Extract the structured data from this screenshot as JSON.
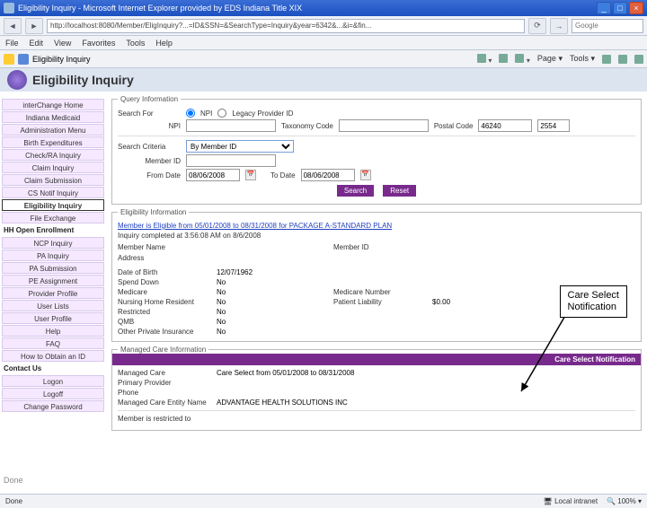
{
  "window": {
    "title": "Eligibility Inquiry - Microsoft Internet Explorer provided by EDS Indiana Title XIX",
    "min": "_",
    "max": "□",
    "close": "×"
  },
  "toolbar": {
    "back": "◄",
    "fwd": "►",
    "refresh": "⟳",
    "go": "→",
    "url": "http://localhost:8080/Member/EligInquiry?...=ID&SSN=&SearchType=Inquiry&year=6342&...&i=&fin...",
    "search_placeholder": "Google"
  },
  "menu": {
    "file": "File",
    "edit": "Edit",
    "view": "View",
    "favorites": "Favorites",
    "tools": "Tools",
    "help": "Help"
  },
  "linkbar": {
    "tab": "Eligibility Inquiry",
    "home": "▾",
    "print": "▾",
    "page": "Page ▾",
    "tools": "Tools ▾"
  },
  "page": {
    "title": "Eligibility Inquiry"
  },
  "sidebar": {
    "items": [
      {
        "label": "interChange Home"
      },
      {
        "label": "Indiana Medicaid"
      },
      {
        "label": "Administration Menu"
      },
      {
        "label": "Birth Expenditures"
      },
      {
        "label": "Check/RA Inquiry"
      },
      {
        "label": "Claim Inquiry"
      },
      {
        "label": "Claim Submission"
      },
      {
        "label": "CS Notif Inquiry"
      },
      {
        "label": "Eligibility Inquiry"
      },
      {
        "label": "File Exchange"
      },
      {
        "label": "HH Open Enrollment"
      },
      {
        "label": "NCP Inquiry"
      },
      {
        "label": "PA Inquiry"
      },
      {
        "label": "PA Submission"
      },
      {
        "label": "PE Assignment"
      },
      {
        "label": "Provider Profile"
      },
      {
        "label": "User Lists"
      },
      {
        "label": "User Profile"
      },
      {
        "label": "Help"
      },
      {
        "label": "FAQ"
      },
      {
        "label": "How to Obtain an ID"
      },
      {
        "label": "Contact Us"
      },
      {
        "label": "Logon"
      },
      {
        "label": "Logoff"
      },
      {
        "label": "Change Password"
      }
    ],
    "active_index": 8,
    "heading_indices": [
      10,
      21
    ]
  },
  "query": {
    "legend": "Query Information",
    "search_for": "Search For",
    "npi": "NPI",
    "legacy": "Legacy Provider ID",
    "npi_label": "NPI",
    "taxonomy": "Taxonomy Code",
    "zip": "Postal Code",
    "zip_val1": "46240",
    "zip_val2": "2554",
    "criteria_label": "Search Criteria",
    "criteria_val": "By Member ID",
    "member_label": "Member ID",
    "from_label": "From Date",
    "from_val": "08/06/2008",
    "to_label": "To Date",
    "to_val": "08/06/2008",
    "search": "Search",
    "reset": "Reset"
  },
  "elig": {
    "legend": "Eligibility Information",
    "line1": "Member is Eligible from 05/01/2008 to 08/31/2008 for PACKAGE A-STANDARD PLAN",
    "line2": "Inquiry completed at 3:56:08 AM on 8/6/2008",
    "member_name": "Member Name",
    "member_id": "Member ID",
    "address": "Address",
    "dob": "Date of Birth",
    "dob_val": "12/07/1962",
    "spend": "Spend Down",
    "spend_val": "No",
    "medicare": "Medicare",
    "medicare_val": "No",
    "medicare_num": "Medicare Number",
    "nursing": "Nursing Home Resident",
    "nursing_val": "No",
    "liability": "Patient Liability",
    "liability_val": "$0.00",
    "restricted": "Restricted",
    "restricted_val": "No",
    "qmb": "QMB",
    "qmb_val": "No",
    "other": "Other Private Insurance",
    "other_val": "No"
  },
  "managed": {
    "legend": "Managed Care Information",
    "bar": "Care Select Notification",
    "mc_label": "Managed Care",
    "mc_val": "Care Select from 05/01/2008 to 08/31/2008",
    "pp": "Primary Provider",
    "phone": "Phone",
    "entity_label": "Managed Care Entity Name",
    "entity_val": "ADVANTAGE HEALTH SOLUTIONS INC",
    "restricted": "Member is restricted to"
  },
  "callout": {
    "l1": "Care Select",
    "l2": "Notification"
  },
  "status": {
    "done": "Done",
    "zone": "Local intranet",
    "zoom": "100%"
  },
  "footer": "Done"
}
